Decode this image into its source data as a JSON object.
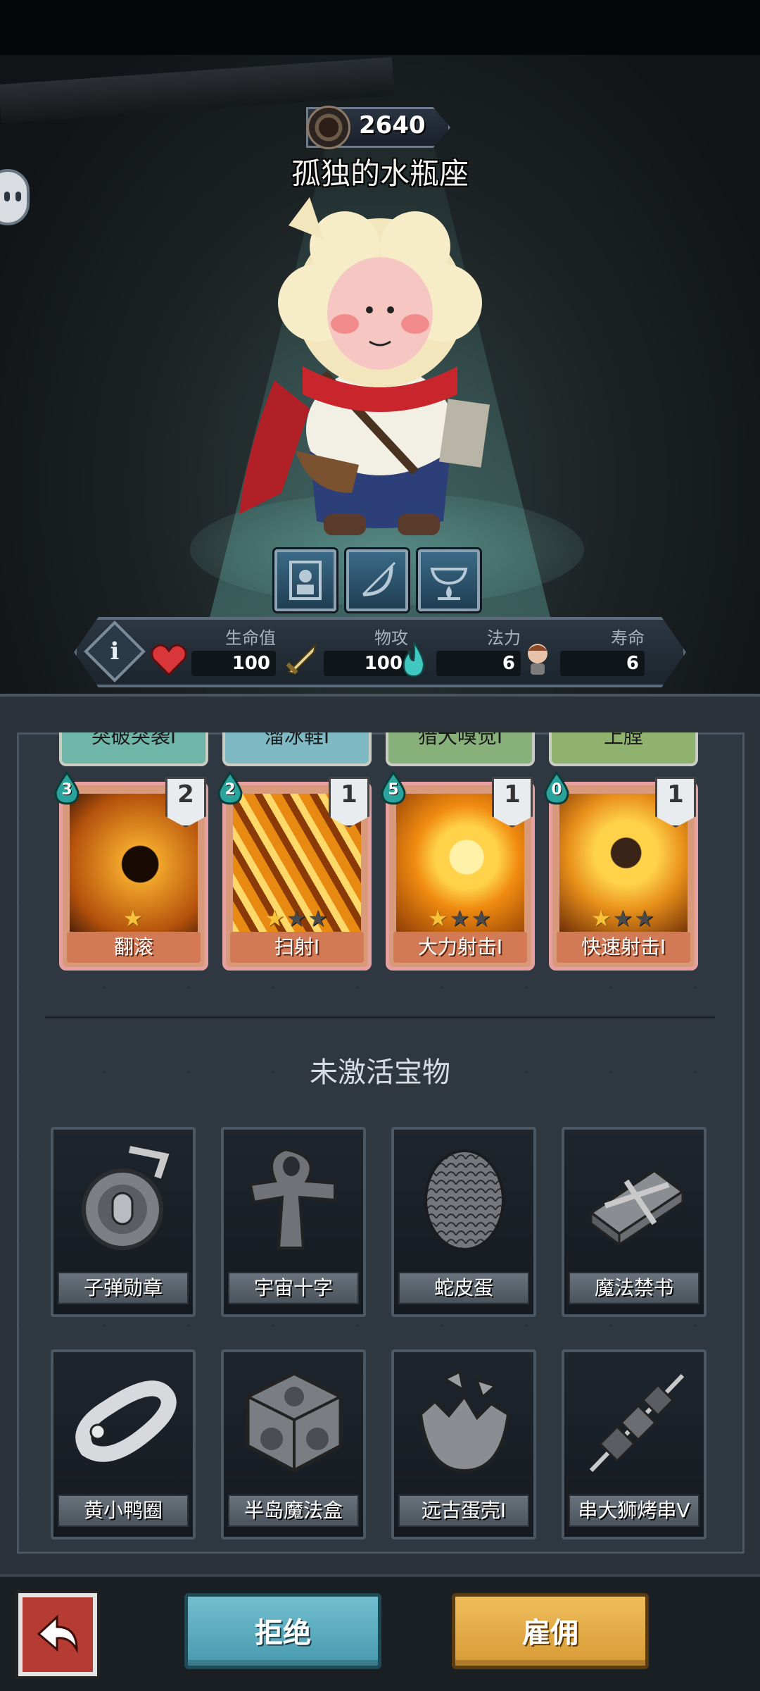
{
  "header": {
    "power": "2640",
    "name": "孤独的水瓶座"
  },
  "stats": {
    "hp_label": "生命值",
    "hp_value": "100",
    "atk_label": "物攻",
    "atk_value": "100",
    "mana_label": "法力",
    "mana_value": "6",
    "life_label": "寿命",
    "life_value": "6"
  },
  "peek_cards": [
    "突破突袭I",
    "溜冰鞋I",
    "猎犬嗅觉I",
    "上膛"
  ],
  "skills": [
    {
      "name": "翻滚",
      "cost": "3",
      "level": "2",
      "stars": 1,
      "star_total": 1
    },
    {
      "name": "扫射I",
      "cost": "2",
      "level": "1",
      "stars": 1,
      "star_total": 3
    },
    {
      "name": "大力射击I",
      "cost": "5",
      "level": "1",
      "stars": 1,
      "star_total": 3
    },
    {
      "name": "快速射击I",
      "cost": "0",
      "level": "1",
      "stars": 1,
      "star_total": 3
    }
  ],
  "section_title": "未激活宝物",
  "treasures": [
    {
      "name": "子弹勋章",
      "icon": "medal-icon"
    },
    {
      "name": "宇宙十字",
      "icon": "ankh-cross-icon"
    },
    {
      "name": "蛇皮蛋",
      "icon": "scaled-egg-icon"
    },
    {
      "name": "魔法禁书",
      "icon": "chained-book-icon"
    },
    {
      "name": "黄小鸭圈",
      "icon": "duck-ring-icon"
    },
    {
      "name": "半岛魔法盒",
      "icon": "magic-cube-icon"
    },
    {
      "name": "远古蛋壳I",
      "icon": "eggshell-icon"
    },
    {
      "name": "串大狮烤串V",
      "icon": "skewer-icon"
    }
  ],
  "buttons": {
    "reject": "拒绝",
    "hire": "雇佣"
  },
  "colors": {
    "reject": "#5aaec0",
    "hire": "#e3aa46",
    "back": "#b53b33",
    "star": "#f5c23a"
  }
}
